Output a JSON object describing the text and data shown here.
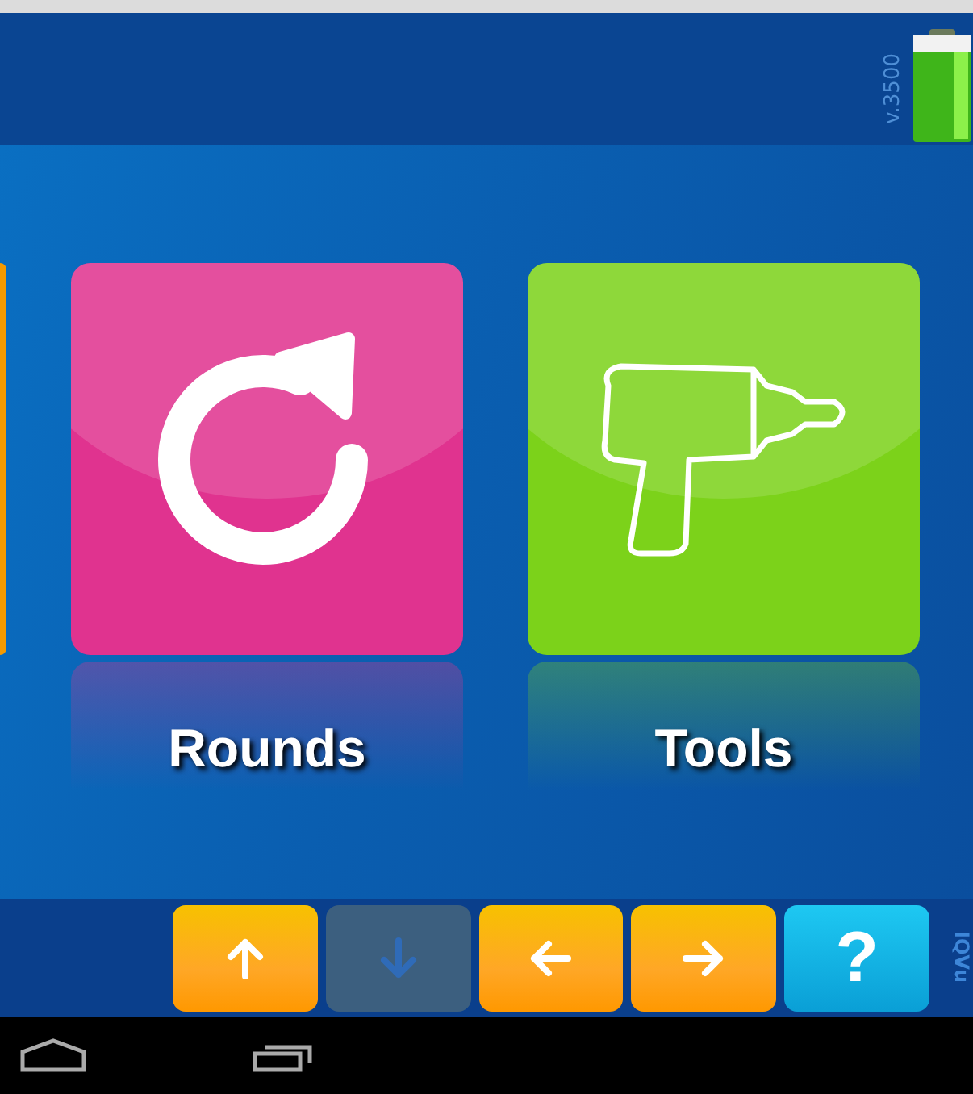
{
  "header": {
    "version": "v.3500"
  },
  "tiles": [
    {
      "kind": "clipped",
      "color": "#f59a00"
    },
    {
      "kind": "refresh",
      "color": "#e0338f",
      "label": "Rounds"
    },
    {
      "kind": "drill",
      "color": "#7cd21a",
      "label": "Tools"
    }
  ],
  "nav_buttons": [
    {
      "kind": "up",
      "disabled": false
    },
    {
      "kind": "down",
      "disabled": true
    },
    {
      "kind": "left",
      "disabled": false
    },
    {
      "kind": "right",
      "disabled": false
    },
    {
      "kind": "help",
      "disabled": false,
      "label": "?"
    }
  ],
  "brand": "IQVu"
}
